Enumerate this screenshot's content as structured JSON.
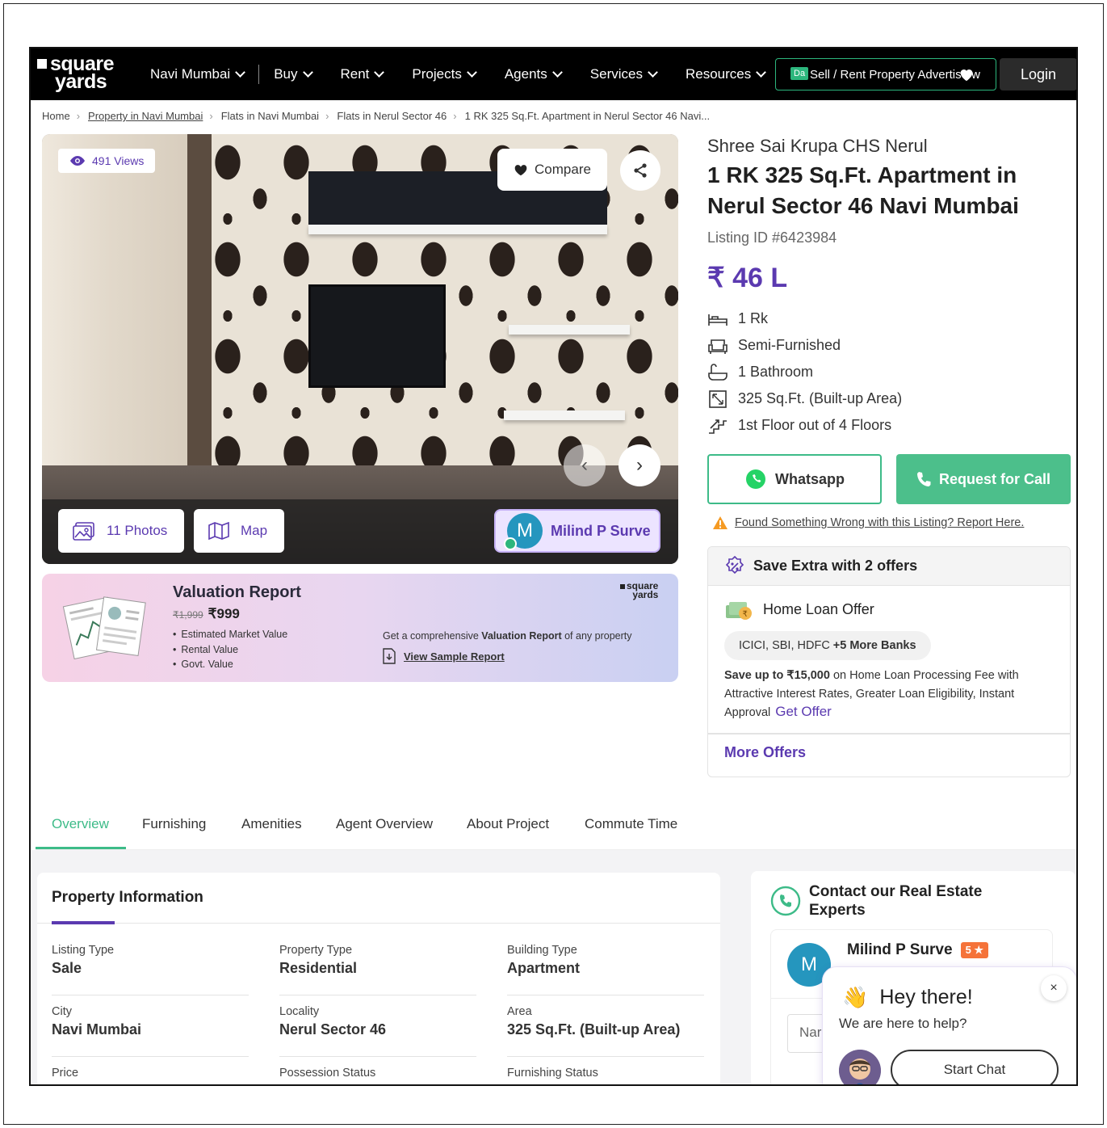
{
  "header": {
    "logo_line1": "square",
    "logo_line2": "yards",
    "nav": [
      {
        "label": "Navi Mumbai"
      },
      {
        "label": "Buy"
      },
      {
        "label": "Rent"
      },
      {
        "label": "Projects"
      },
      {
        "label": "Agents"
      },
      {
        "label": "Services"
      },
      {
        "label": "Resources"
      }
    ],
    "post_ad_label": "Sell / Rent Property Advertise w",
    "post_ad_tag": "Da",
    "login_label": "Login"
  },
  "breadcrumb": {
    "items": [
      "Home",
      "Property in Navi Mumbai",
      "Flats in Navi Mumbai",
      "Flats in Nerul Sector 46",
      "1 RK 325 Sq.Ft. Apartment in Nerul Sector 46 Navi..."
    ]
  },
  "gallery": {
    "views": "491 Views",
    "compare_label": "Compare",
    "photos_label": "11 Photos",
    "map_label": "Map",
    "agent_initial": "M",
    "agent_name": "Milind P Surve"
  },
  "valuation": {
    "title": "Valuation Report",
    "old_price": "₹1,999",
    "price": "₹999",
    "bullets": [
      "Estimated Market Value",
      "Rental Value",
      "Govt. Value"
    ],
    "logo_line1": "square",
    "logo_line2": "yards",
    "desc_prefix": "Get a comprehensive ",
    "desc_bold": "Valuation Report",
    "desc_suffix": " of any property",
    "link_label": "View Sample Report"
  },
  "listing": {
    "society": "Shree Sai Krupa CHS Nerul",
    "title": "1 RK 325 Sq.Ft. Apartment in Nerul Sector 46 Navi Mumbai",
    "listing_id": "Listing ID #6423984",
    "price": "₹ 46 L",
    "features": [
      {
        "icon": "bed-icon",
        "label": "1 Rk"
      },
      {
        "icon": "sofa-icon",
        "label": "Semi-Furnished"
      },
      {
        "icon": "bathtub-icon",
        "label": "1 Bathroom"
      },
      {
        "icon": "area-icon",
        "label": "325 Sq.Ft. (Built-up Area)"
      },
      {
        "icon": "stairs-icon",
        "label": "1st Floor out of 4 Floors"
      }
    ],
    "whatsapp_label": "Whatsapp",
    "call_label": "Request for Call",
    "report_label": "Found Something Wrong with this Listing? Report Here."
  },
  "offers": {
    "header": "Save Extra with 2 offers",
    "loan_title": "Home Loan Offer",
    "banks": "ICICI, SBI, HDFC",
    "banks_more": "+5 More Banks",
    "desc_bold": "Save up to ₹15,000",
    "desc_rest": " on Home Loan Processing Fee with Attractive Interest Rates, Greater Loan Eligibility, Instant Approval",
    "get_offer_label": "Get Offer",
    "more_offers_label": "More Offers"
  },
  "tabs": [
    "Overview",
    "Furnishing",
    "Amenities",
    "Agent Overview",
    "About Project",
    "Commute Time"
  ],
  "property_info": {
    "title": "Property Information",
    "cells": [
      {
        "label": "Listing Type",
        "value": "Sale"
      },
      {
        "label": "Property Type",
        "value": "Residential"
      },
      {
        "label": "Building Type",
        "value": "Apartment"
      },
      {
        "label": "City",
        "value": "Navi Mumbai"
      },
      {
        "label": "Locality",
        "value": "Nerul Sector 46"
      },
      {
        "label": "Area",
        "value": "325 Sq.Ft. (Built-up Area)"
      },
      {
        "label": "Price",
        "value": ""
      },
      {
        "label": "Possession Status",
        "value": ""
      },
      {
        "label": "Furnishing Status",
        "value": ""
      }
    ]
  },
  "contact": {
    "title": "Contact our Real Estate Experts",
    "agent_initial": "M",
    "agent_name": "Milind P Surve",
    "rating": "5 ★",
    "name_placeholder": "Nar"
  },
  "chat": {
    "greeting": "Hey there!",
    "subtitle": "We are here to help?",
    "start_label": "Start Chat",
    "close_label": "×"
  },
  "colors": {
    "accent_purple": "#5b3ab0",
    "accent_green": "#3dbb88",
    "nav_bg": "#000000"
  }
}
